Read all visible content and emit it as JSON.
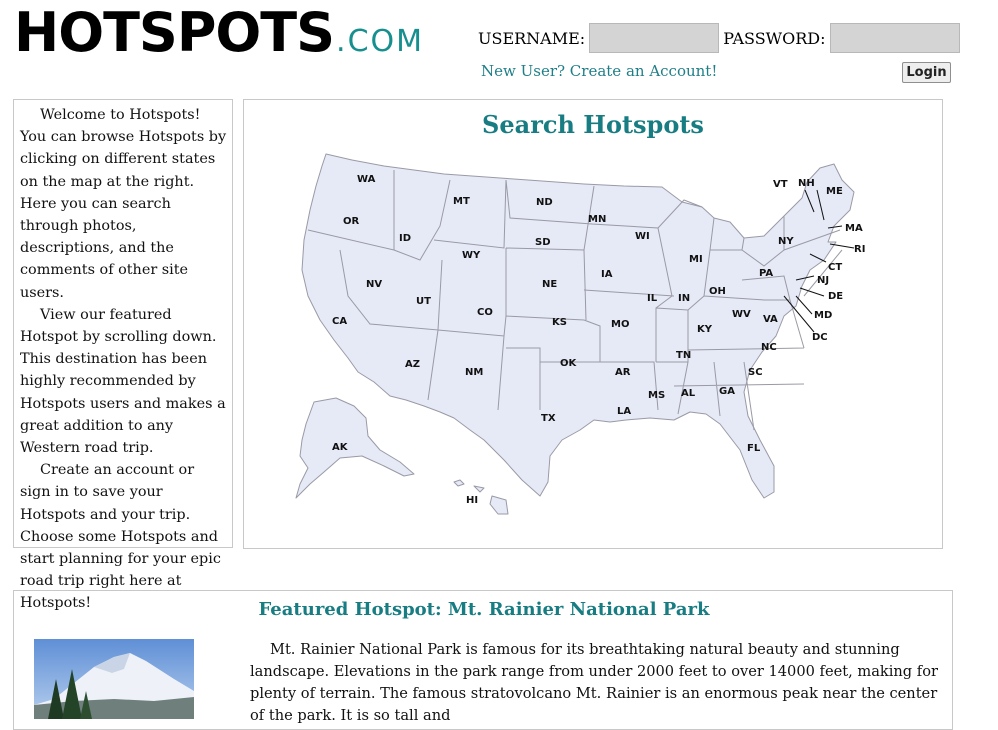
{
  "logo": {
    "main": "HOTSPOTS",
    "tld": ".COM"
  },
  "login": {
    "username_label": "USERNAME:",
    "password_label": "PASSWORD:",
    "new_user_link": "New User? Create an Account!",
    "button_label": "Login"
  },
  "intro": {
    "paragraphs": [
      "Welcome to Hotspots! You can browse Hotspots by clicking on different states on the map at the right. Here you can search through photos, descriptions, and the comments of other site users.",
      "View our featured Hotspot by scrolling down. This destination has been highly recommended by Hotspots users and makes a great addition to any Western road trip.",
      "Create an account or sign in to save your Hotspots and your trip. Choose some Hotspots and start planning for your epic road trip right here at Hotspots!"
    ]
  },
  "map": {
    "title": "Search Hotspots",
    "states": {
      "WA": "WA",
      "OR": "OR",
      "CA": "CA",
      "ID": "ID",
      "NV": "NV",
      "MT": "MT",
      "WY": "WY",
      "UT": "UT",
      "AZ": "AZ",
      "CO": "CO",
      "NM": "NM",
      "ND": "ND",
      "SD": "SD",
      "NE": "NE",
      "KS": "KS",
      "OK": "OK",
      "TX": "TX",
      "MN": "MN",
      "IA": "IA",
      "MO": "MO",
      "AR": "AR",
      "LA": "LA",
      "WI": "WI",
      "IL": "IL",
      "MI": "MI",
      "IN": "IN",
      "OH": "OH",
      "KY": "KY",
      "TN": "TN",
      "MS": "MS",
      "AL": "AL",
      "GA": "GA",
      "FL": "FL",
      "SC": "SC",
      "NC": "NC",
      "VA": "VA",
      "WV": "WV",
      "PA": "PA",
      "NY": "NY",
      "VT": "VT",
      "NH": "NH",
      "ME": "ME",
      "MA": "MA",
      "RI": "RI",
      "CT": "CT",
      "NJ": "NJ",
      "DE": "DE",
      "MD": "MD",
      "DC": "DC",
      "AK": "AK",
      "HI": "HI"
    }
  },
  "featured": {
    "title": "Featured Hotspot: Mt. Rainier National Park",
    "text": "Mt. Rainier National Park is famous for its breathtaking natural beauty and stunning landscape. Elevations in the park range from under 2000 feet to over 14000 feet, making for plenty of terrain. The famous stratovolcano Mt. Rainier is an enormous peak near the center of the park. It is so tall and"
  },
  "colors": {
    "accent": "#187d82",
    "map_fill": "#e6e9f6",
    "map_stroke": "#9a9aa6"
  }
}
